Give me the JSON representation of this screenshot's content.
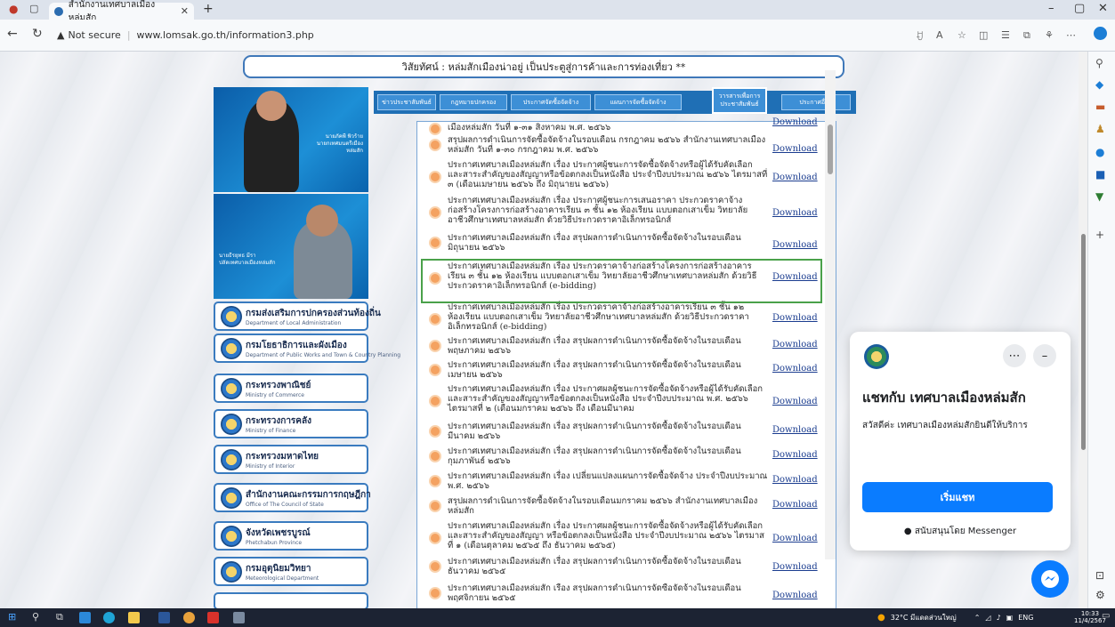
{
  "browser": {
    "tab_title": "สำนักงานเทศบาลเมืองหล่มสัก",
    "url_warning": "Not secure",
    "url": "www.lomsak.go.th/information3.php"
  },
  "page": {
    "marquee": "วิสัยทัศน์ : หล่มสักเมืองน่าอยู่ เป็นประตูสู่การค้าและการท่องเที่ยว **",
    "photo1_name": "นายภัคพี พิวร้าย",
    "photo1_title": "นายกเทศมนตรีเมืองหล่มสัก",
    "photo2_name": "นายธีรยุทธ มีรา",
    "photo2_title": "ปลัดเทศบาลเมืองหล่มสัก",
    "nav_tabs": [
      "ข่าวประชาสัมพันธ์",
      "กฎหมายปกครอง",
      "ประกาศจัดซื้อจัดจ้าง",
      "แผนการจัดซื้อจัดจ้าง",
      "วารสารเพื่อการประชาสัมพันธ์",
      "ประกาศอื่นๆ"
    ],
    "download_label": "Download",
    "rows": [
      "เมืองหล่มสัก วันที่ ๑-๓๑ สิงหาคม พ.ศ. ๒๕๖๖",
      "สรุปผลการดำเนินการจัดซื้อจัดจ้างในรอบเดือน กรกฎาคม ๒๕๖๖ สำนักงานเทศบาลเมืองหล่มสัก วันที่ ๑-๓๐ กรกฎาคม พ.ศ. ๒๕๖๖",
      "ประกาศเทศบาลเมืองหล่มสัก เรื่อง ประกาศผู้ชนะการจัดซื้อจัดจ้างหรือผู้ได้รับคัดเลือก และสาระสำคัญของสัญญาหรือข้อตกลงเป็นหนังสือ ประจำปีงบประมาณ ๒๕๖๖ ไตรมาสที่ ๓ (เดือนเมษายน ๒๕๖๖ ถึง มิถุนายน ๒๕๖๖)",
      "ประกาศเทศบาลเมืองหล่มสัก เรื่อง ประกาศผู้ชนะการเสนอราคา ประกวดราคาจ้างก่อสร้างโครงการก่อสร้างอาคารเรียน ๓ ชั้น ๑๒ ห้องเรียน แบบตอกเสาเข็ม วิทยาลัยอาชีวศึกษาเทศบาลหล่มสัก ด้วยวิธีประกวดราคาอิเล็กทรอนิกส์",
      "ประกาศเทศบาลเมืองหล่มสัก เรื่อง สรุปผลการดำเนินการจัดซื้อจัดจ้างในรอบเดือน มิถุนายน ๒๕๖๖",
      "ประกาศเทศบาลเมืองหล่มสัก เรื่อง ประกวดราคาจ้างก่อสร้างโครงการก่อสร้างอาคารเรียน ๓ ชั้น ๑๒ ห้องเรียน แบบตอกเสาเข็ม วิทยาลัยอาชีวศึกษาเทศบาลหล่มสัก ด้วยวิธีประกวดราคาอิเล็กทรอนิกส์ (e-bidding)",
      "ประกาศเทศบาลเมืองหล่มสัก เรื่อง ประกวดราคาจ้างก่อสร้างอาคารเรียน ๓ ชั้น ๑๒ ห้องเรียน แบบตอกเสาเข็ม วิทยาลัยอาชีวศึกษาเทศบาลหล่มสัก ด้วยวิธีประกวดราคาอิเล็กทรอนิกส์ (e-bidding)",
      "ประกาศเทศบาลเมืองหล่มสัก เรื่อง สรุปผลการดำเนินการจัดซื้อจัดจ้างในรอบเดือน พฤษภาคม ๒๕๖๖",
      "ประกาศเทศบาลเมืองหล่มสัก เรื่อง สรุปผลการดำเนินการจัดซื้อจัดจ้างในรอบเดือน เมษายน ๒๕๖๖",
      "ประกาศเทศบาลเมืองหล่มสัก เรื่อง ประกาศผลผู้ชนะการจัดซื้อจัดจ้างหรือผู้ได้รับคัดเลือก และสาระสำคัญของสัญญาหรือข้อตกลงเป็นหนังสือ ประจำปีงบประมาณ พ.ศ. ๒๕๖๖ ไตรมาสที่ ๒ (เดือนมกราคม ๒๕๖๖ ถึง เดือนมีนาคม",
      "ประกาศเทศบาลเมืองหล่มสัก เรื่อง สรุปผลการดำเนินการจัดซื้อจัดจ้างในรอบเดือน มีนาคม ๒๕๖๖",
      "ประกาศเทศบาลเมืองหล่มสัก เรื่อง สรุปผลการดำเนินการจัดซื้อจัดจ้างในรอบเดือน กุมภาพันธ์ ๒๕๖๖",
      "ประกาศเทศบาลเมืองหล่มสัก เรื่อง เปลี่ยนแปลงแผนการจัดซื้อจัดจ้าง ประจำปีงบประมาณ พ.ศ. ๒๕๖๖",
      "สรุปผลการดำเนินการจัดซื้อจัดจ้างในรอบเดือนมกราคม ๒๕๖๖ สำนักงานเทศบาลเมืองหล่มสัก",
      "ประกาศเทศบาลเมืองหล่มสัก เรื่อง ประกาศผลผู้ชนะการจัดซื้อจัดจ้างหรือผู้ได้รับคัดเลือก และสาระสำคัญของสัญญา หรือข้อตกลงเป็นหนังสือ ประจำปีงบประมาณ ๒๕๖๖ ไตรมาสที่ ๑ (เดือนตุลาคม ๒๕๖๕ ถึง ธันวาคม ๒๕๖๕)",
      "ประกาศเทศบาลเมืองหล่มสัก เรื่อง สรุปผลการดำเนินการจัดซื้อจัดจ้างในรอบเดือน ธันวาคม ๒๕๖๕",
      "ประกาศเทศบาลเมืองหล่มสัก เรื่อง สรุปผลการดำเนินการจัดซื้อจัดจ้างในรอบเดือน พฤศจิกายน ๒๕๖๕"
    ],
    "links": [
      {
        "th": "กรมส่งเสริมการปกครองส่วนท้องถิ่น",
        "en": "Department of Local Administration"
      },
      {
        "th": "กรมโยธาธิการและผังเมือง",
        "en": "Department of Public Works and Town & Country Planning"
      },
      {
        "th": "กระทรวงพาณิชย์",
        "en": "Ministry of Commerce"
      },
      {
        "th": "กระทรวงการคลัง",
        "en": "Ministry of Finance"
      },
      {
        "th": "กระทรวงมหาดไทย",
        "en": "Ministry of Interior"
      },
      {
        "th": "สำนักงานคณะกรรมการกฤษฎีกา",
        "en": "Office of The Council of State"
      },
      {
        "th": "จังหวัดเพชรบูรณ์",
        "en": "Phetchabun Province"
      },
      {
        "th": "กรมอุตุนิยมวิทยา",
        "en": "Meteorological Department"
      }
    ]
  },
  "chat": {
    "title": "แชทกับ เทศบาลเมืองหล่มสัก",
    "greeting": "สวัสดีค่ะ เทศบาลเมืองหล่มสักยินดีให้บริการ",
    "start_button": "เริ่มแชท",
    "powered_by": "สนับสนุนโดย Messenger"
  },
  "taskbar": {
    "weather": "32°C มีแดดส่วนใหญ่",
    "lang": "ENG",
    "time": "10:33",
    "date": "11/4/2567"
  },
  "colors": {
    "accent": "#1f6fb5",
    "highlight": "#4aa14a",
    "messenger": "#0a7cff"
  }
}
